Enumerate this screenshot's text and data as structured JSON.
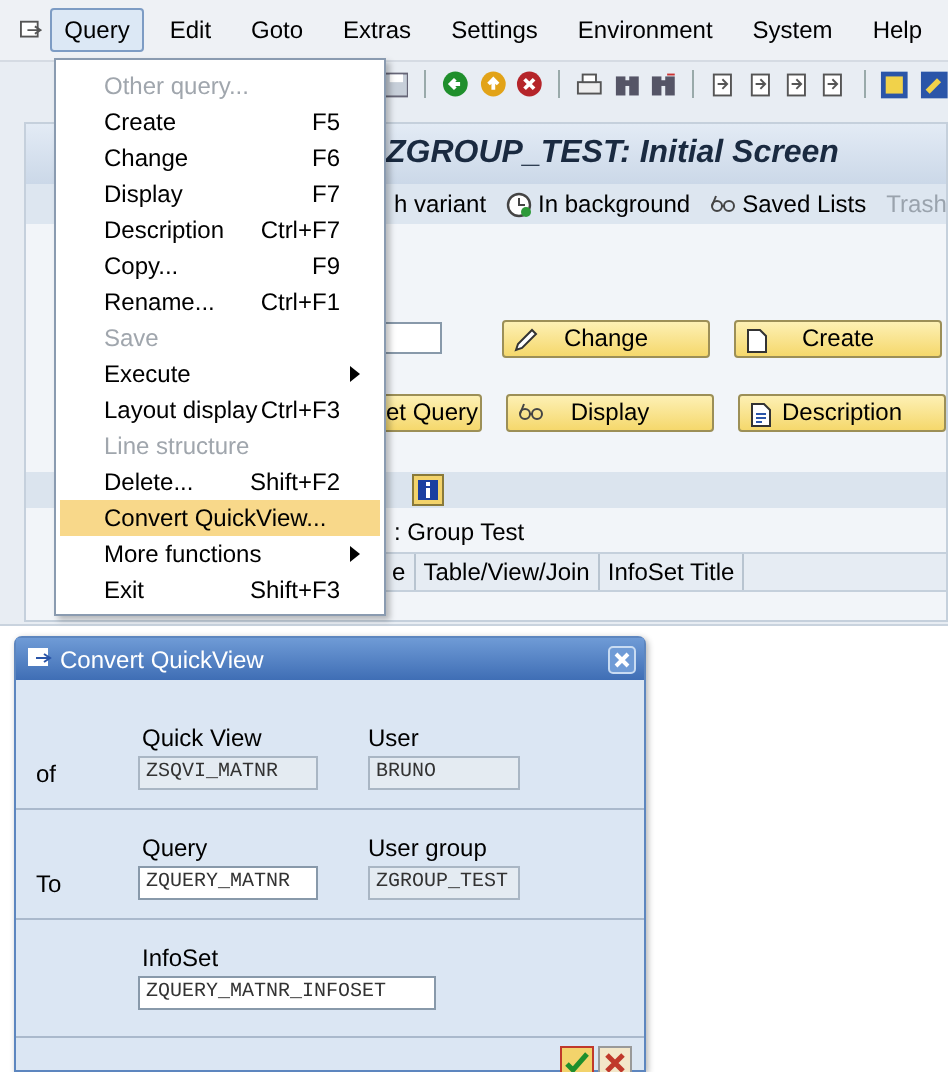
{
  "menubar": [
    {
      "label": "Query",
      "selected": true
    },
    {
      "label": "Edit",
      "selected": false
    },
    {
      "label": "Goto",
      "selected": false
    },
    {
      "label": "Extras",
      "selected": false
    },
    {
      "label": "Settings",
      "selected": false
    },
    {
      "label": "Environment",
      "selected": false
    },
    {
      "label": "System",
      "selected": false
    },
    {
      "label": "Help",
      "selected": false
    }
  ],
  "title": "ZGROUP_TEST: Initial Screen",
  "app_toolbar": [
    {
      "label": "h variant",
      "kind": "plain",
      "disabled": false
    },
    {
      "label": "In background",
      "kind": "clock",
      "disabled": false
    },
    {
      "label": "Saved Lists",
      "kind": "glasses",
      "disabled": false
    },
    {
      "label": "Trash",
      "kind": "plain",
      "disabled": true
    }
  ],
  "buttons": [
    {
      "label": "Change",
      "kind": "pencil"
    },
    {
      "label": "Create",
      "kind": "page"
    },
    {
      "label": "et Query",
      "kind": "plain"
    },
    {
      "label": "Display",
      "kind": "glasses"
    },
    {
      "label": "Description",
      "kind": "doc"
    }
  ],
  "group_label": ": Group Test",
  "table": {
    "columns": [
      "e",
      "Table/View/Join",
      "InfoSet Title"
    ]
  },
  "menu": {
    "items": [
      {
        "label": "Other query...",
        "kind": "item",
        "disabled": true,
        "selected": false
      },
      {
        "label": "Create",
        "shortcut": "F5",
        "kind": "item",
        "disabled": false,
        "selected": false
      },
      {
        "label": "Change",
        "shortcut": "F6",
        "kind": "item",
        "disabled": false,
        "selected": false
      },
      {
        "label": "Display",
        "shortcut": "F7",
        "kind": "item",
        "disabled": false,
        "selected": false
      },
      {
        "label": "Description",
        "shortcut": "Ctrl+F7",
        "kind": "item",
        "disabled": false,
        "selected": false
      },
      {
        "label": "Copy...",
        "shortcut": "F9",
        "kind": "item",
        "disabled": false,
        "selected": false
      },
      {
        "label": "Rename...",
        "shortcut": "Ctrl+F1",
        "kind": "item",
        "disabled": false,
        "selected": false
      },
      {
        "label": "Save",
        "kind": "item",
        "disabled": true,
        "selected": false
      },
      {
        "label": "Execute",
        "kind": "submenu",
        "disabled": false,
        "selected": false
      },
      {
        "label": "Layout display",
        "shortcut": "Ctrl+F3",
        "kind": "item",
        "disabled": false,
        "selected": false
      },
      {
        "label": "Line structure",
        "kind": "item",
        "disabled": true,
        "selected": false
      },
      {
        "label": "Delete...",
        "shortcut": "Shift+F2",
        "kind": "item",
        "disabled": false,
        "selected": false
      },
      {
        "label": "Convert QuickView...",
        "kind": "item",
        "disabled": false,
        "selected": true
      },
      {
        "label": "More functions",
        "kind": "submenu",
        "disabled": false,
        "selected": false
      },
      {
        "label": "Exit",
        "shortcut": "Shift+F3",
        "kind": "item",
        "disabled": false,
        "selected": false
      }
    ]
  },
  "dialog": {
    "title": "Convert QuickView",
    "sections": [
      {
        "label": "of",
        "fields": [
          {
            "caption": "Quick View",
            "value": "ZSQVI_MATNR",
            "readonly": true
          },
          {
            "caption": "User",
            "value": "BRUNO",
            "readonly": true
          }
        ]
      },
      {
        "label": "To",
        "fields": [
          {
            "caption": "Query",
            "value": "ZQUERY_MATNR",
            "readonly": false
          },
          {
            "caption": "User group",
            "value": "ZGROUP_TEST",
            "readonly": true
          }
        ]
      }
    ],
    "infoset": {
      "caption": "InfoSet",
      "value": "ZQUERY_MATNR_INFOSET",
      "readonly": false
    }
  }
}
